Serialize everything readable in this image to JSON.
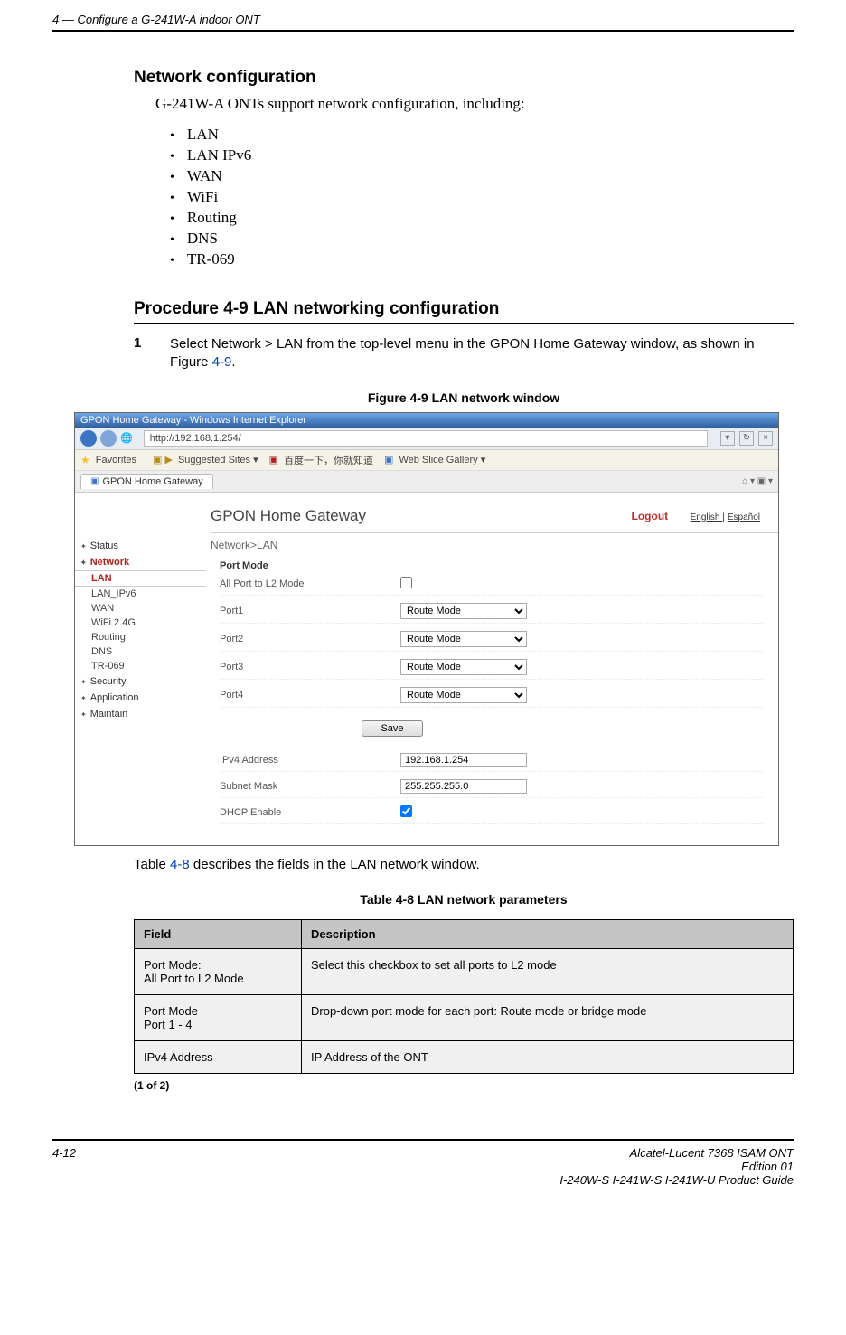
{
  "header": {
    "running_head": "4 — Configure a G-241W-A indoor ONT"
  },
  "section": {
    "title": "Network configuration",
    "intro": "G-241W-A ONTs support network configuration, including:",
    "bullets": [
      "LAN",
      "LAN IPv6",
      "WAN",
      "WiFi",
      "Routing",
      "DNS",
      "TR-069"
    ]
  },
  "procedure": {
    "heading": "Procedure 4-9  LAN networking configuration",
    "step_num": "1",
    "step_text_1": "Select Network > LAN from the top-level menu in the GPON Home Gateway window, as shown in Figure ",
    "step_link": "4-9",
    "step_text_2": "."
  },
  "figure": {
    "caption": "Figure 4-9  LAN network window",
    "browser_title": "GPON Home Gateway - Windows Internet Explorer",
    "address": "http://192.168.1.254/",
    "fav_label": "Favorites",
    "suggested": "Suggested Sites ▾",
    "baidu": "百度一下，你就知道",
    "webslice": "Web Slice Gallery ▾",
    "tab_label": "GPON Home Gateway",
    "app_title": "GPON Home Gateway",
    "logout": "Logout",
    "lang_en": "English |",
    "lang_es": "Español",
    "breadcrumb": "Network>LAN",
    "side_status": "Status",
    "side_network": "Network",
    "side_lan": "LAN",
    "side_lan_ipv6": "LAN_IPv6",
    "side_wan": "WAN",
    "side_wifi": "WiFi 2.4G",
    "side_routing": "Routing",
    "side_dns": "DNS",
    "side_tr069": "TR-069",
    "side_security": "Security",
    "side_application": "Application",
    "side_maintain": "Maintain",
    "port_mode_heading": "Port Mode",
    "all_port": "All Port to L2 Mode",
    "p1": "Port1",
    "p2": "Port2",
    "p3": "Port3",
    "p4": "Port4",
    "route_mode": "Route Mode",
    "save": "Save",
    "ipv4_label": "IPv4 Address",
    "ipv4_value": "192.168.1.254",
    "subnet_label": "Subnet Mask",
    "subnet_value": "255.255.255.0",
    "dhcp_label": "DHCP Enable"
  },
  "after_figure": {
    "text1": "Table ",
    "link": "4-8",
    "text2": " describes the fields in the LAN network window."
  },
  "table": {
    "caption": "Table 4-8 LAN network parameters",
    "head_field": "Field",
    "head_desc": "Description",
    "r1_field_a": "Port Mode:",
    "r1_field_b": "All Port to L2 Mode",
    "r1_desc": "Select this checkbox to set all ports to L2 mode",
    "r2_field_a": "Port Mode",
    "r2_field_b": "Port 1 - 4",
    "r2_desc": "Drop-down port mode for each port: Route mode or bridge mode",
    "r3_field": "IPv4 Address",
    "r3_desc": "IP Address of the ONT",
    "note": "(1 of 2)"
  },
  "footer": {
    "page_num": "4-12",
    "line1": "Alcatel-Lucent 7368 ISAM ONT",
    "line2": "Edition 01",
    "line3": "I-240W-S I-241W-S I-241W-U Product Guide"
  }
}
